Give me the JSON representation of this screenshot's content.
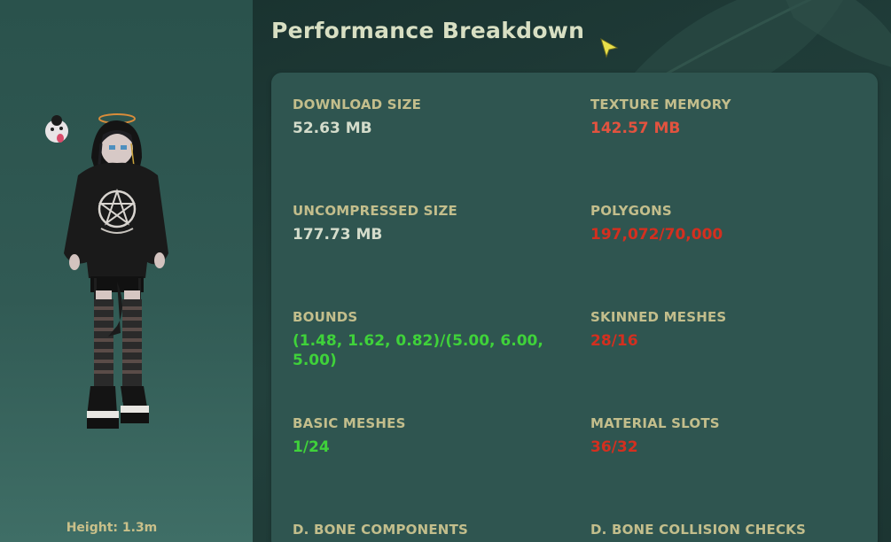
{
  "header": {
    "title": "Performance Breakdown"
  },
  "avatar_panel": {
    "height_label": "Height: 1.3m"
  },
  "stats": [
    {
      "label": "DOWNLOAD SIZE",
      "value": "52.63 MB",
      "status": "neutral"
    },
    {
      "label": "TEXTURE MEMORY",
      "value": "142.57 MB",
      "status": "warn"
    },
    {
      "label": "UNCOMPRESSED SIZE",
      "value": "177.73 MB",
      "status": "neutral"
    },
    {
      "label": "POLYGONS",
      "value": "197,072/70,000",
      "status": "bad"
    },
    {
      "label": "BOUNDS",
      "value": "(1.48, 1.62, 0.82)/(5.00, 6.00, 5.00)",
      "status": "good"
    },
    {
      "label": "SKINNED MESHES",
      "value": "28/16",
      "status": "bad"
    },
    {
      "label": "BASIC MESHES",
      "value": "1/24",
      "status": "good"
    },
    {
      "label": "MATERIAL SLOTS",
      "value": "36/32",
      "status": "bad"
    },
    {
      "label": "D. BONE COMPONENTS",
      "value": "",
      "status": "neutral"
    },
    {
      "label": "D. BONE COLLISION CHECKS",
      "value": "",
      "status": "neutral"
    }
  ],
  "colors": {
    "label": "#c3be8c",
    "neutral": "#d4dccb",
    "warn": "#e2533f",
    "bad": "#d42f1f",
    "good": "#3fd23a",
    "card": "#2f5550"
  },
  "icons": {
    "cursor": "cursor-arrow-icon"
  }
}
